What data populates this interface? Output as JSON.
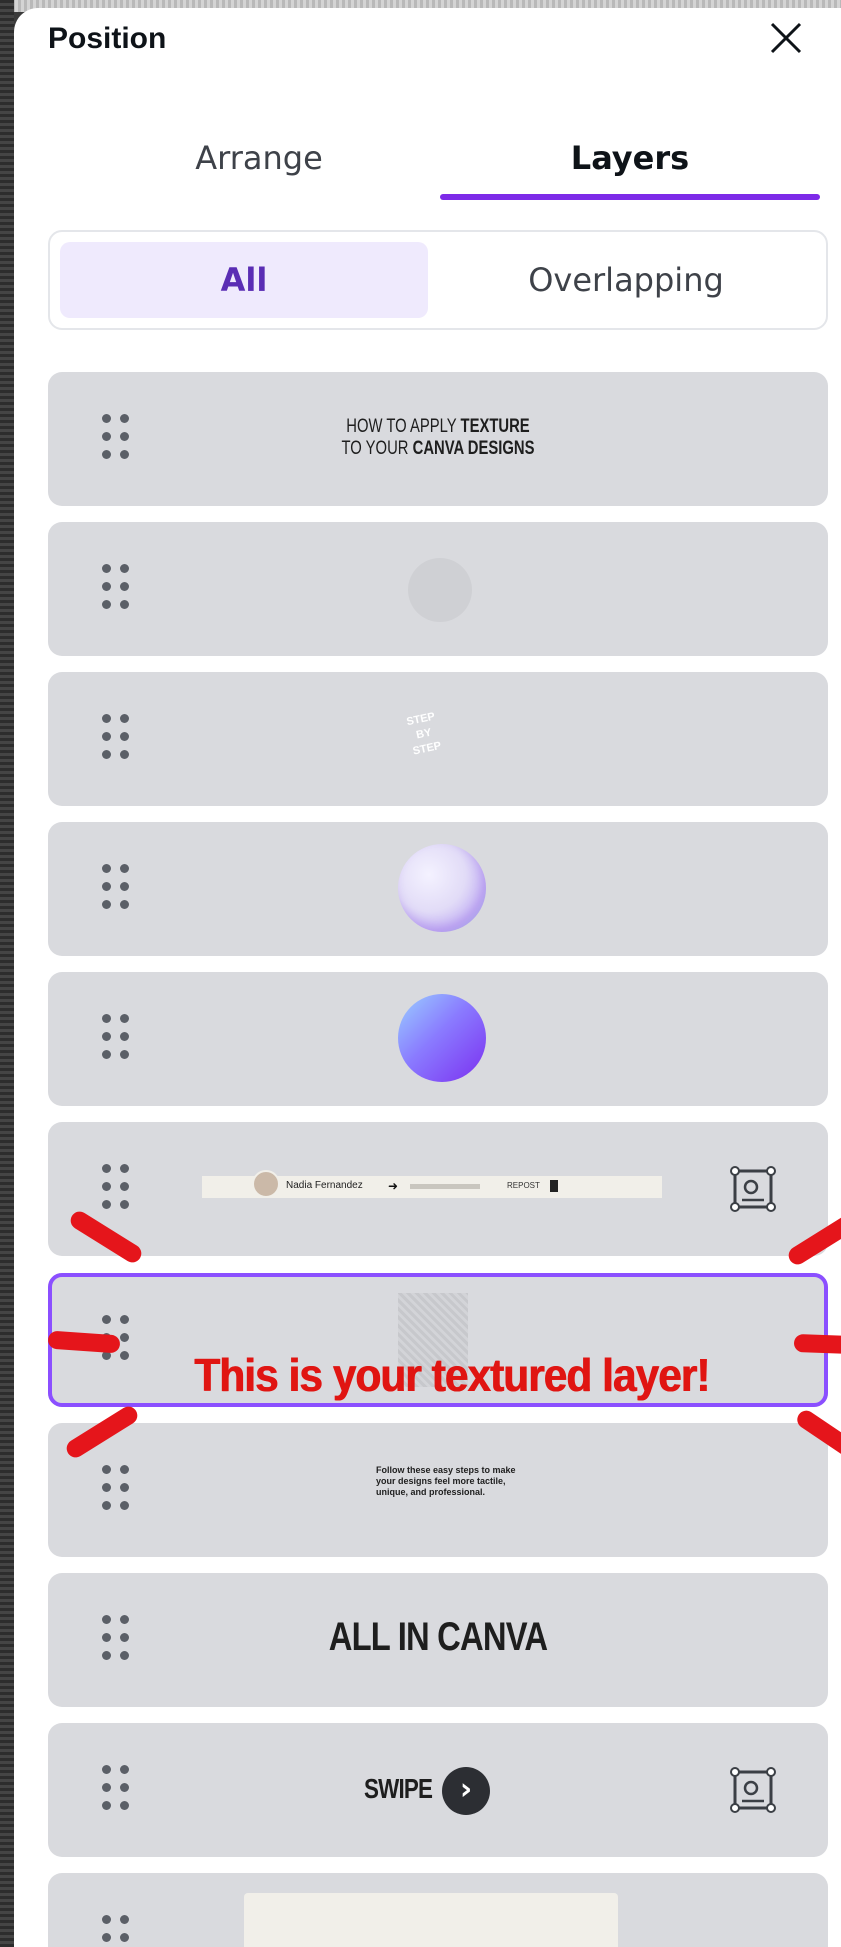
{
  "header": {
    "title": "Position",
    "close_icon": "close-icon"
  },
  "tabs": [
    {
      "label": "Arrange",
      "active": false
    },
    {
      "label": "Layers",
      "active": true
    }
  ],
  "filter": {
    "all_label": "All",
    "overlapping_label": "Overlapping",
    "selected": "All"
  },
  "layers": [
    {
      "preview": "HOW TO APPLY TEXTURE TO YOUR CANVA DESIGNS",
      "line1": "HOW TO APPLY ",
      "line1_bold": "TEXTURE",
      "line2": "TO YOUR ",
      "line2_bold": "CANVA DESIGNS"
    },
    {
      "preview": "faint circle graphic"
    },
    {
      "preview": "STEP BY STEP",
      "text": "STEP BY STEP"
    },
    {
      "preview": "bubble graphic"
    },
    {
      "preview": "gradient circle"
    },
    {
      "preview": "author bar",
      "author_name": "Nadia Fernandez",
      "repost": "REPOST",
      "has_frame_icon": true
    },
    {
      "preview": "texture image",
      "selected": true
    },
    {
      "preview": "body text",
      "text": "Follow these easy steps to make your designs feel more tactile, unique, and professional."
    },
    {
      "preview": "ALL IN CANVA",
      "text": "ALL IN CANVA"
    },
    {
      "preview": "SWIPE",
      "text": "SWIPE",
      "has_frame_icon": true
    },
    {
      "preview": "rectangle"
    }
  ],
  "annotation": {
    "text": "This is your textured layer!",
    "color": "#e01512"
  },
  "colors": {
    "accent": "#7d2ae8",
    "selection": "#8b4fff",
    "row_bg": "#d9dade"
  }
}
